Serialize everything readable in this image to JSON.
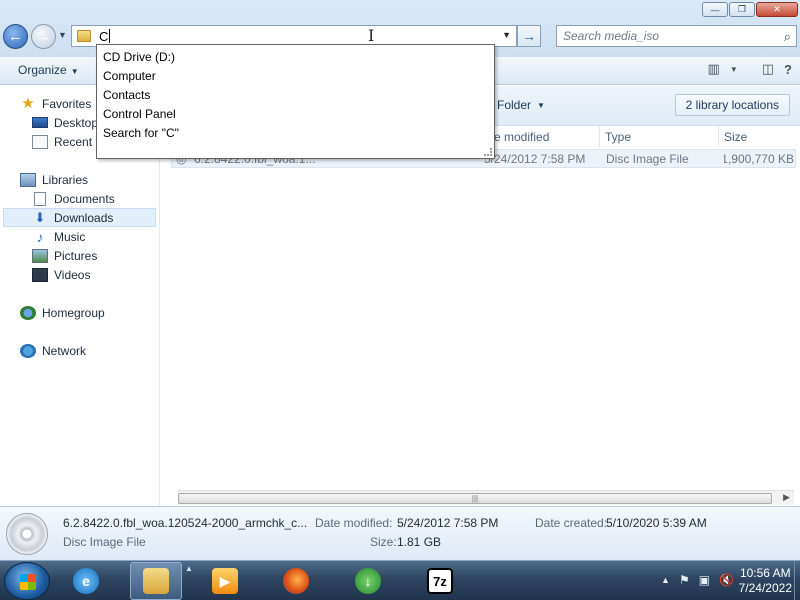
{
  "address_bar": {
    "text": "C",
    "search_placeholder": "Search media_iso"
  },
  "window_controls": {
    "minimize": "—",
    "maximize": "❐",
    "close": "✕"
  },
  "toolbar": {
    "organize": "Organize"
  },
  "autocomplete": [
    "CD Drive (D:)",
    "Computer",
    "Contacts",
    "Control Panel",
    "Search for \"C\""
  ],
  "sidebar": {
    "favorites": "Favorites",
    "favorites_items": [
      "Desktop",
      "Recent P"
    ],
    "libraries": "Libraries",
    "library_items": [
      "Documents",
      "Downloads",
      "Music",
      "Pictures",
      "Videos"
    ],
    "selected": "Downloads",
    "homegroup": "Homegroup",
    "network": "Network"
  },
  "library_header": {
    "arrange": "Folder",
    "locations": "2 library locations"
  },
  "columns": {
    "date": "ate modified",
    "type": "Type",
    "size": "Size"
  },
  "file": {
    "name": "6.2.8422.0.fbl_woa.1...",
    "date": "5/24/2012 7:58 PM",
    "type": "Disc Image File",
    "size": "1,900,770 KB"
  },
  "details": {
    "name": "6.2.8422.0.fbl_woa.120524-2000_armchk_c...",
    "type": "Disc Image File",
    "modified_label": "Date modified:",
    "modified_value": "5/24/2012 7:58 PM",
    "created_label": "Date created:",
    "created_value": "5/10/2020 5:39 AM",
    "size_label": "Size:",
    "size_value": "1.81 GB"
  },
  "taskbar": {
    "seven_zip": "7z",
    "time": "10:56 AM",
    "date": "7/24/2022"
  }
}
